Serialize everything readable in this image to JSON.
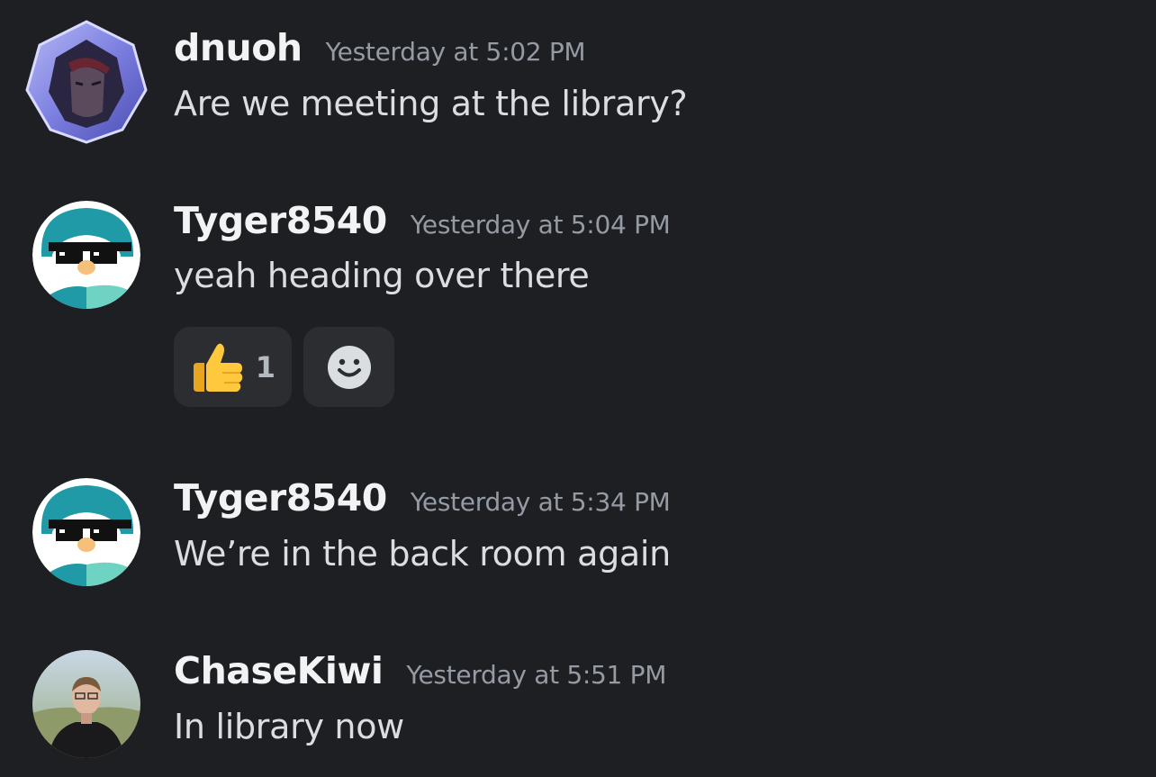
{
  "messages": [
    {
      "username": "dnuoh",
      "timestamp": "Yesterday at 5:02 PM",
      "text": "Are we meeting at the library?",
      "avatar": "hooded-character-avatar"
    },
    {
      "username": "Tyger8540",
      "timestamp": "Yesterday at 5:04 PM",
      "text": "yeah heading over there",
      "avatar": "penguin-sunglasses-avatar",
      "reactions": [
        {
          "emoji": "thumbs-up-icon",
          "count": "1"
        }
      ],
      "add_reaction_icon": "smiley-add-reaction-icon"
    },
    {
      "username": "Tyger8540",
      "timestamp": "Yesterday at 5:34 PM",
      "text": "We’re in the back room again",
      "avatar": "penguin-sunglasses-avatar"
    },
    {
      "username": "ChaseKiwi",
      "timestamp": "Yesterday at 5:51 PM",
      "text": "In library now",
      "avatar": "person-photo-avatar"
    }
  ],
  "colors": {
    "background": "#1e1f22",
    "username": "#f2f3f5",
    "timestamp": "#949ba4",
    "message_text": "#dbdee1",
    "reaction_bg": "#2b2d31"
  }
}
